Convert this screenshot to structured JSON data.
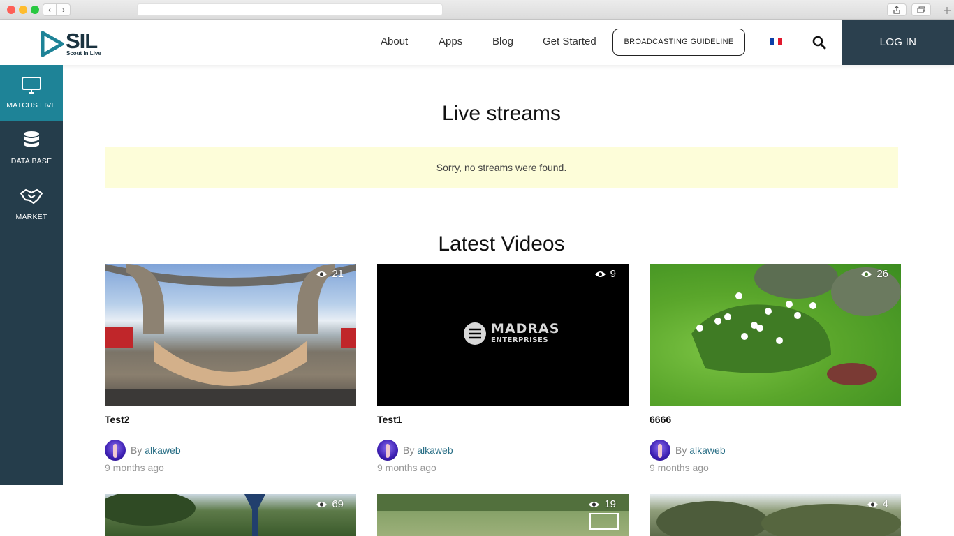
{
  "browser": {
    "back": "‹",
    "forward": "›",
    "url": ""
  },
  "header": {
    "logo_text": "SIL",
    "logo_sub": "Scout In Live",
    "nav": [
      "About",
      "Apps",
      "Blog",
      "Get Started"
    ],
    "guideline_label": "BROADCASTING GUIDELINE",
    "login_label": "LOG IN",
    "flag_colors": [
      "#0b3fa8",
      "#ffffff",
      "#e0182d"
    ]
  },
  "sidebar": {
    "items": [
      {
        "label": "MATCHS LIVE",
        "icon": "monitor-icon",
        "active": true
      },
      {
        "label": "DATA BASE",
        "icon": "database-icon",
        "active": false
      },
      {
        "label": "MARKET",
        "icon": "handshake-icon",
        "active": false
      }
    ]
  },
  "live": {
    "title": "Live streams",
    "notice": "Sorry, no streams were found."
  },
  "latest": {
    "title": "Latest Videos",
    "videos": [
      {
        "title": "Test2",
        "views": "21",
        "by": "By ",
        "author": "alkaweb",
        "ago": "9 months ago"
      },
      {
        "title": "Test1",
        "views": "9",
        "by": "By ",
        "author": "alkaweb",
        "ago": "9 months ago",
        "thumb_text_1": "MADRAS",
        "thumb_text_2": "ENTERPRISES"
      },
      {
        "title": "6666",
        "views": "26",
        "by": "By ",
        "author": "alkaweb",
        "ago": "9 months ago"
      },
      {
        "views": "69"
      },
      {
        "views": "19"
      },
      {
        "views": "4"
      }
    ]
  },
  "colors": {
    "sidebar_bg": "#253d4b",
    "sidebar_active": "#1e8397",
    "login_bg": "#2b404e",
    "notice_bg": "#fdfdd9",
    "author_link": "#2a6f86"
  }
}
